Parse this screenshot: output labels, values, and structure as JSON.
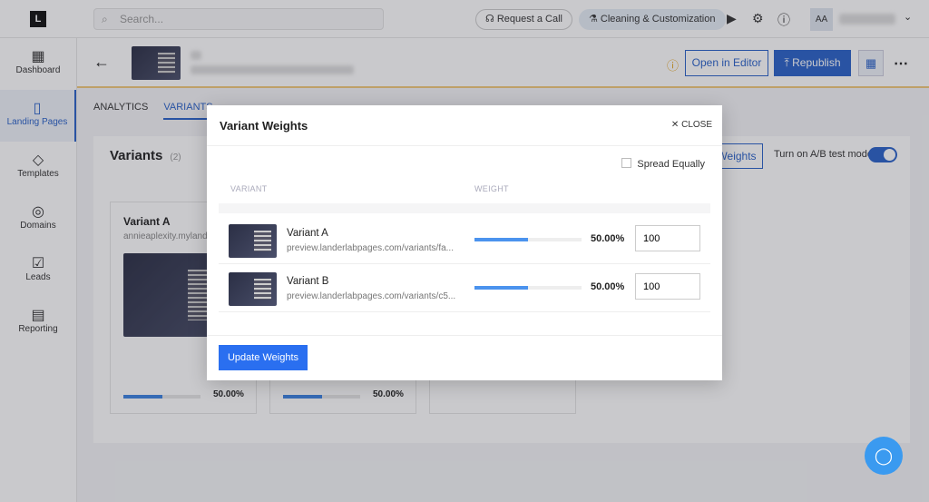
{
  "topbar": {
    "search_placeholder": "Search...",
    "request_call": "Request a Call",
    "cleaning": "Cleaning & Customization",
    "avatar": "AA"
  },
  "sidebar": {
    "items": [
      {
        "label": "Dashboard",
        "icon": "grid-icon"
      },
      {
        "label": "Landing Pages",
        "icon": "phone-icon"
      },
      {
        "label": "Templates",
        "icon": "templates-icon"
      },
      {
        "label": "Domains",
        "icon": "globe-icon"
      },
      {
        "label": "Leads",
        "icon": "leads-icon"
      },
      {
        "label": "Reporting",
        "icon": "chart-icon"
      }
    ]
  },
  "header": {
    "open_editor": "Open in Editor",
    "republish": "Republish"
  },
  "tabs": {
    "analytics": "ANALYTICS",
    "variants": "VARIANTS"
  },
  "panel": {
    "title": "Variants",
    "count": "(2)",
    "weights_btn": "Weights",
    "ab_label": "Turn on A/B test mode",
    "ab_on": true,
    "cards": [
      {
        "name": "Variant A",
        "url": "annieaplexity.mylanderlabpages.com",
        "pct": "50.00%",
        "fill": 50
      },
      {
        "name": "",
        "url": "",
        "pct": "50.00%",
        "fill": 50
      }
    ]
  },
  "modal": {
    "title": "Variant Weights",
    "close": "CLOSE",
    "spread": "Spread Equally",
    "col_variant": "VARIANT",
    "col_weight": "WEIGHT",
    "rows": [
      {
        "name": "Variant A",
        "url": "preview.landerlabpages.com/variants/fa...",
        "pct": "50.00%",
        "fill": 50,
        "value": "100"
      },
      {
        "name": "Variant B",
        "url": "preview.landerlabpages.com/variants/c5...",
        "pct": "50.00%",
        "fill": 50,
        "value": "100"
      }
    ],
    "update": "Update Weights"
  },
  "colors": {
    "primary": "#2a62c9",
    "bar": "#4b93ee",
    "warning": "#f0c97a"
  }
}
